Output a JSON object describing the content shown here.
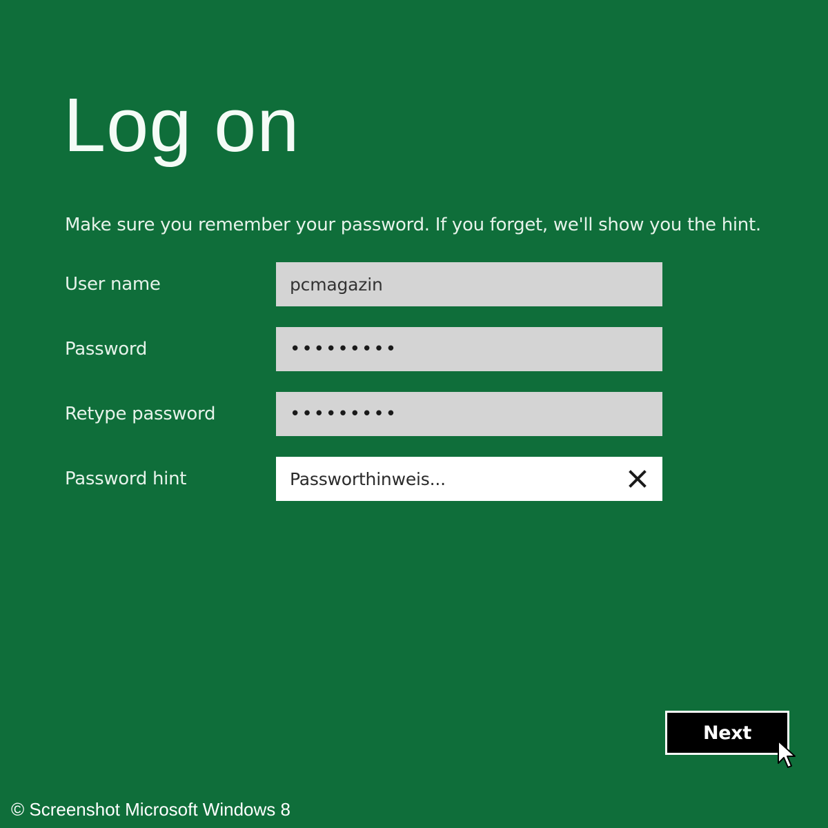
{
  "page": {
    "title": "Log on",
    "instructions": "Make sure you remember your password. If you forget, we'll show you the hint."
  },
  "form": {
    "username": {
      "label": "User name",
      "value": "pcmagazin"
    },
    "password": {
      "label": "Password",
      "value": "•••••••••"
    },
    "retype_password": {
      "label": "Retype password",
      "value": "•••••••••"
    },
    "password_hint": {
      "label": "Password hint",
      "value": "Passworthinweis..."
    }
  },
  "actions": {
    "next_label": "Next"
  },
  "icons": {
    "clear": "close-icon",
    "cursor": "mouse-pointer-icon"
  },
  "footer": {
    "copyright": "© Screenshot Microsoft Windows 8"
  },
  "colors": {
    "background": "#0f6e3a",
    "input_inactive": "#d4d4d4",
    "input_active": "#ffffff",
    "button": "#000000"
  }
}
